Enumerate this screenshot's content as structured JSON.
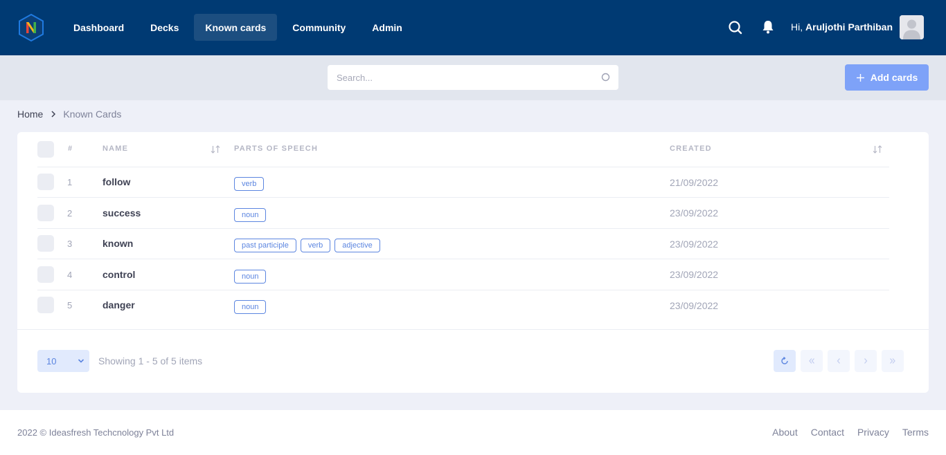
{
  "colors": {
    "navbar": "#003a73",
    "nav_active": "#1c4e80",
    "accent": "#7ea2f8",
    "tag": "#5b85e0"
  },
  "nav": {
    "items": [
      {
        "label": "Dashboard",
        "active": false
      },
      {
        "label": "Decks",
        "active": false
      },
      {
        "label": "Known cards",
        "active": true
      },
      {
        "label": "Community",
        "active": false
      },
      {
        "label": "Admin",
        "active": false
      }
    ],
    "greeting_prefix": "Hi,",
    "user_name": "Aruljothi Parthiban",
    "icons": {
      "logo": "n-hexagon-logo",
      "search": "search-icon",
      "notifications": "bell-icon",
      "avatar": "user-avatar"
    }
  },
  "toolbar": {
    "search_placeholder": "Search...",
    "add_label": "Add cards"
  },
  "breadcrumb": {
    "home": "Home",
    "current": "Known Cards"
  },
  "table": {
    "headers": {
      "num": "#",
      "name": "NAME",
      "pos": "PARTS OF SPEECH",
      "created": "CREATED"
    },
    "rows": [
      {
        "num": "1",
        "name": "follow",
        "pos": [
          "verb"
        ],
        "created": "21/09/2022"
      },
      {
        "num": "2",
        "name": "success",
        "pos": [
          "noun"
        ],
        "created": "23/09/2022"
      },
      {
        "num": "3",
        "name": "known",
        "pos": [
          "past participle",
          "verb",
          "adjective"
        ],
        "created": "23/09/2022"
      },
      {
        "num": "4",
        "name": "control",
        "pos": [
          "noun"
        ],
        "created": "23/09/2022"
      },
      {
        "num": "5",
        "name": "danger",
        "pos": [
          "noun"
        ],
        "created": "23/09/2022"
      }
    ]
  },
  "pagination": {
    "page_size": "10",
    "info": "Showing 1 - 5 of 5 items"
  },
  "footer": {
    "copyright": "2022 © Ideasfresh Techcnology Pvt Ltd",
    "links": [
      "About",
      "Contact",
      "Privacy",
      "Terms"
    ]
  }
}
